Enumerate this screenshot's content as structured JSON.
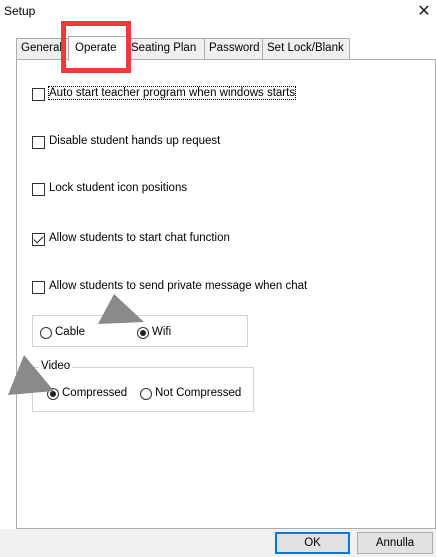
{
  "window": {
    "title": "Setup",
    "close_glyph": "✕"
  },
  "tabs": [
    {
      "label": "General",
      "active": false
    },
    {
      "label": "Operate",
      "active": true
    },
    {
      "label": "Seating Plan",
      "active": false
    },
    {
      "label": "Password",
      "active": false
    },
    {
      "label": "Set Lock/Blank",
      "active": false
    }
  ],
  "options": {
    "auto_start": {
      "label": "Auto start teacher program when windows starts",
      "checked": false
    },
    "disable_hands_up": {
      "label": "Disable student hands up request",
      "checked": false
    },
    "lock_icons": {
      "label": "Lock student icon positions",
      "checked": false
    },
    "allow_chat": {
      "label": "Allow students to start chat function",
      "checked": true
    },
    "allow_private": {
      "label": "Allow students to send private message when chat",
      "checked": false
    }
  },
  "connection": {
    "options": [
      {
        "label": "Cable",
        "selected": false
      },
      {
        "label": "Wifi",
        "selected": true
      }
    ]
  },
  "video": {
    "caption": "Video",
    "options": [
      {
        "label": "Compressed",
        "selected": true
      },
      {
        "label": "Not Compressed",
        "selected": false
      }
    ]
  },
  "buttons": {
    "ok": "OK",
    "cancel": "Annulla"
  },
  "colors": {
    "highlight": "#ee3a3a",
    "arrow": "#8a8a8a",
    "default_button": "#0078d7"
  }
}
